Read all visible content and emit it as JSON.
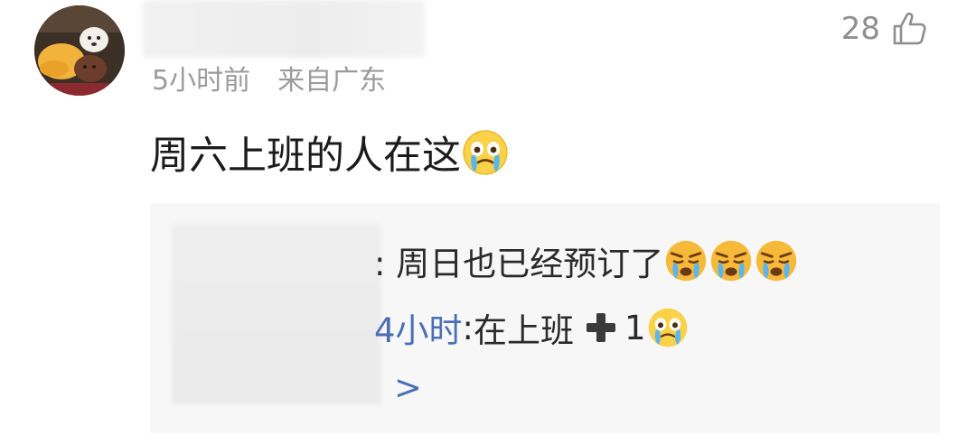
{
  "comment": {
    "like_count": "28",
    "meta": {
      "time": "5小时前",
      "location": "来自广东"
    },
    "text": "周六上班的人在这",
    "text_emoji": "crying-face"
  },
  "replies": {
    "items": [
      {
        "name_visible": "",
        "text": ": 周日也已经预订了",
        "emojis": [
          "angry-crying-face",
          "angry-crying-face",
          "angry-crying-face"
        ]
      },
      {
        "name_visible": "4小时",
        "text_sep": ": ",
        "text": "在上班",
        "suffix": "1",
        "emoji": "crying-face"
      }
    ],
    "more_label": ">"
  },
  "colors": {
    "meta": "#9b9b9b",
    "link": "#4a6fb4",
    "reply_bg": "#f7f7f7"
  },
  "icons": [
    "thumbs-up-icon",
    "crying-face-emoji",
    "angry-crying-face-emoji",
    "plus-icon",
    "chevron-right-icon"
  ]
}
